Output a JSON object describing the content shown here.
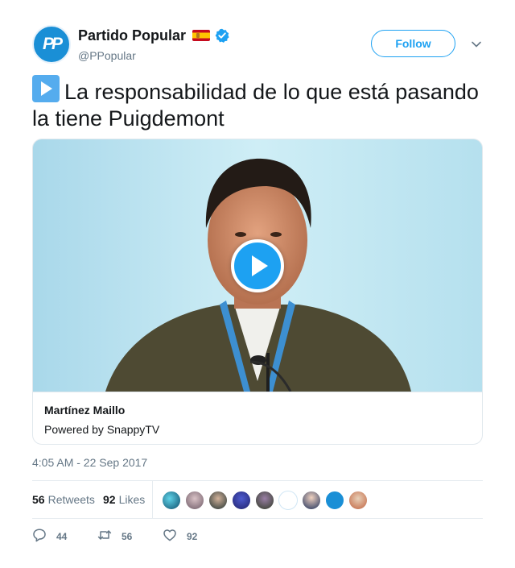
{
  "account": {
    "display_name": "Partido Popular",
    "handle": "@PPopular",
    "avatar_logo": "PP",
    "verified": true
  },
  "follow_label": "Follow",
  "tweet": {
    "text": "La responsabilidad de lo que está pasando la tiene Puigdemont"
  },
  "card": {
    "title": "Martínez Maillo",
    "subtitle": "Powered by SnappyTV"
  },
  "timestamp": "4:05 AM - 22 Sep 2017",
  "stats": {
    "retweets_count": "56",
    "retweets_label": "Retweets",
    "likes_count": "92",
    "likes_label": "Likes"
  },
  "actions": {
    "reply_count": "44",
    "retweet_count": "56",
    "like_count": "92"
  },
  "colors": {
    "accent": "#1da1f2",
    "secondary_text": "#657786"
  },
  "liker_avatars": [
    "avatar-1",
    "avatar-2",
    "avatar-3",
    "avatar-4",
    "avatar-5",
    "avatar-6",
    "avatar-7",
    "avatar-8",
    "avatar-9"
  ]
}
